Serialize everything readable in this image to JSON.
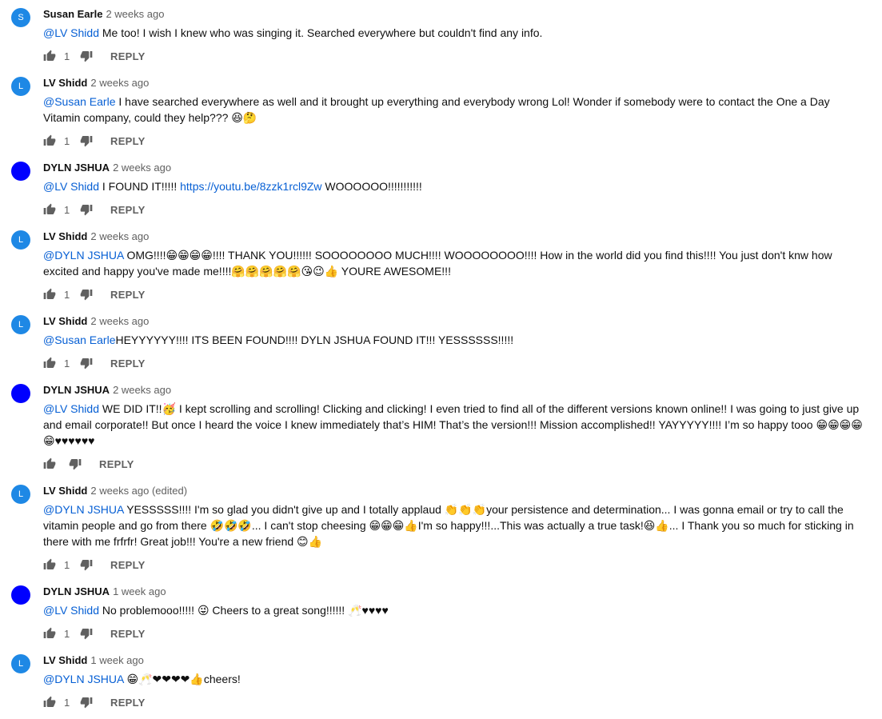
{
  "comments": [
    {
      "author": "Susan Earle",
      "time": "2 weeks ago",
      "avatar_letter": "S",
      "avatar_color": "#1e88e5",
      "mention": "@LV Shidd",
      "text": " Me too!  I wish I knew who was singing it.  Searched everywhere but couldn't find any info.",
      "likes": "1",
      "reply": "REPLY"
    },
    {
      "author": "LV Shidd",
      "time": "2 weeks ago",
      "avatar_letter": "L",
      "avatar_color": "#1e88e5",
      "mention": "@Susan Earle",
      "text": " I have searched everywhere as well and it brought up everything and everybody wrong Lol! Wonder if somebody were to contact the One a Day Vitamin company, could they help??? 😆🤔",
      "likes": "1",
      "reply": "REPLY"
    },
    {
      "author": "DYLN JSHUA",
      "time": "2 weeks ago",
      "avatar_letter": "",
      "avatar_color": "#0000ff",
      "mention": "@LV Shidd",
      "text_before": " I FOUND IT!!!!! ",
      "link": "https://youtu.be/8zzk1rcl9Zw",
      "text_after": " WOOOOOO!!!!!!!!!!!",
      "likes": "1",
      "reply": "REPLY"
    },
    {
      "author": "LV Shidd",
      "time": "2 weeks ago",
      "avatar_letter": "L",
      "avatar_color": "#1e88e5",
      "mention": "@DYLN JSHUA",
      "text": " OMG!!!!😁😁😁😁!!!! THANK YOU!!!!!! SOOOOOOOO MUCH!!!! WOOOOOOOO!!!! How in the world did you find this!!!! You just don't knw how excited and happy  you've made me!!!!🤗🤗🤗🤗🤗😘😉👍 YOURE AWESOME!!!",
      "likes": "1",
      "reply": "REPLY"
    },
    {
      "author": "LV Shidd",
      "time": "2 weeks ago",
      "avatar_letter": "L",
      "avatar_color": "#1e88e5",
      "mention": "@Susan Earle",
      "text": "HEYYYYYY!!!!  ITS BEEN FOUND!!!! DYLN JSHUA FOUND IT!!! YESSSSSS!!!!!",
      "likes": "1",
      "reply": "REPLY"
    },
    {
      "author": "DYLN JSHUA",
      "time": "2 weeks ago",
      "avatar_letter": "",
      "avatar_color": "#0000ff",
      "mention": "@LV Shidd",
      "text": " WE DID IT!!🥳 I kept scrolling and scrolling! Clicking and clicking! I even tried to find all of the different versions known online!! I was going to just give up and email corporate!! But once I heard the voice I knew immediately that’s HIM! That’s the version!!! Mission accomplished!! YAYYYYY!!!! I’m so happy tooo 😁😁😁😁😁♥♥♥♥♥♥",
      "likes": "",
      "reply": "REPLY"
    },
    {
      "author": "LV Shidd",
      "time": "2 weeks ago (edited)",
      "avatar_letter": "L",
      "avatar_color": "#1e88e5",
      "mention": "@DYLN JSHUA",
      "text": " YESSSSS!!!! I'm so glad you didn't give up and I  totally applaud 👏👏👏your persistence and determination... I was gonna email or try to call the vitamin people and go from there 🤣🤣🤣... I can't stop cheesing 😁😁😁👍I'm so happy!!!...This was actually a true task!😆👍... I Thank you so much for sticking in there with me frfrfr! Great job!!! You're a new friend  😊👍",
      "likes": "1",
      "reply": "REPLY"
    },
    {
      "author": "DYLN JSHUA",
      "time": "1 week ago",
      "avatar_letter": "",
      "avatar_color": "#0000ff",
      "mention": "@LV Shidd",
      "text": " No problemooo!!!!! 😜 Cheers to a great song!!!!!! 🥂♥♥♥♥",
      "likes": "1",
      "reply": "REPLY"
    },
    {
      "author": "LV Shidd",
      "time": "1 week ago",
      "avatar_letter": "L",
      "avatar_color": "#1e88e5",
      "mention": "@DYLN JSHUA",
      "text": " 😁🥂❤❤❤❤👍cheers!",
      "likes": "1",
      "reply": "REPLY"
    }
  ]
}
